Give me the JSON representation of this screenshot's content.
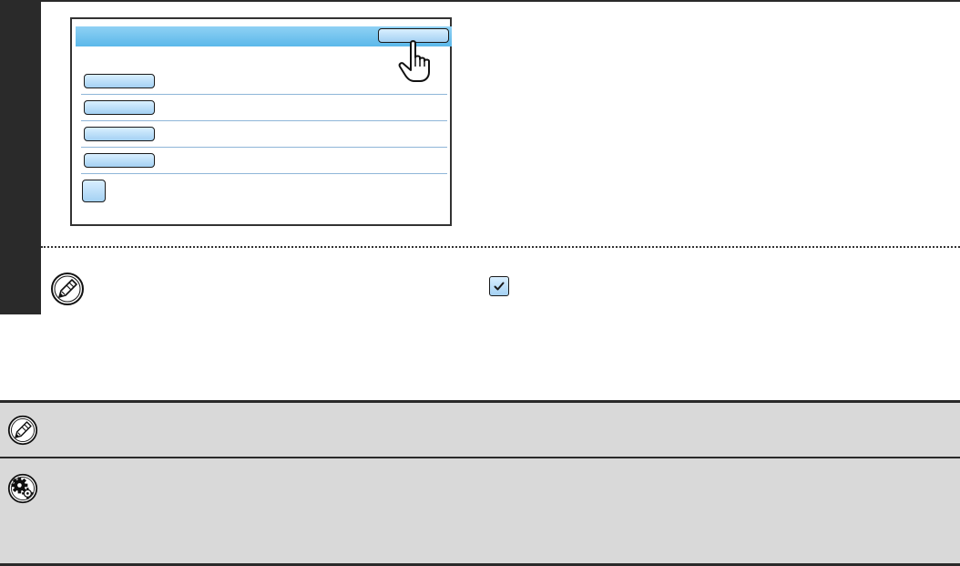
{
  "manual_page": {
    "step": {
      "number": ""
    },
    "panel": {
      "header_title": "",
      "header_button_label": "",
      "rows": [
        {
          "button_label": "",
          "text": ""
        },
        {
          "button_label": "",
          "text": ""
        },
        {
          "button_label": "",
          "text": ""
        },
        {
          "button_label": "",
          "text": ""
        }
      ],
      "small_button_label": ""
    },
    "note": {
      "text": ""
    },
    "info_boxes": {
      "note_text": "",
      "settings_text": ""
    },
    "icons": {
      "hand": "hand-pointer-icon",
      "note": "pencil-note-icon",
      "checkbox": "checkmark-icon",
      "settings": "gears-icon"
    },
    "colors": {
      "accent_blue": "#5bb8ea",
      "button_blue": "#a4d1f3",
      "divider_blue": "#8fb6d8",
      "dark": "#2a2a2a",
      "info_gray": "#d9d9d9"
    }
  }
}
